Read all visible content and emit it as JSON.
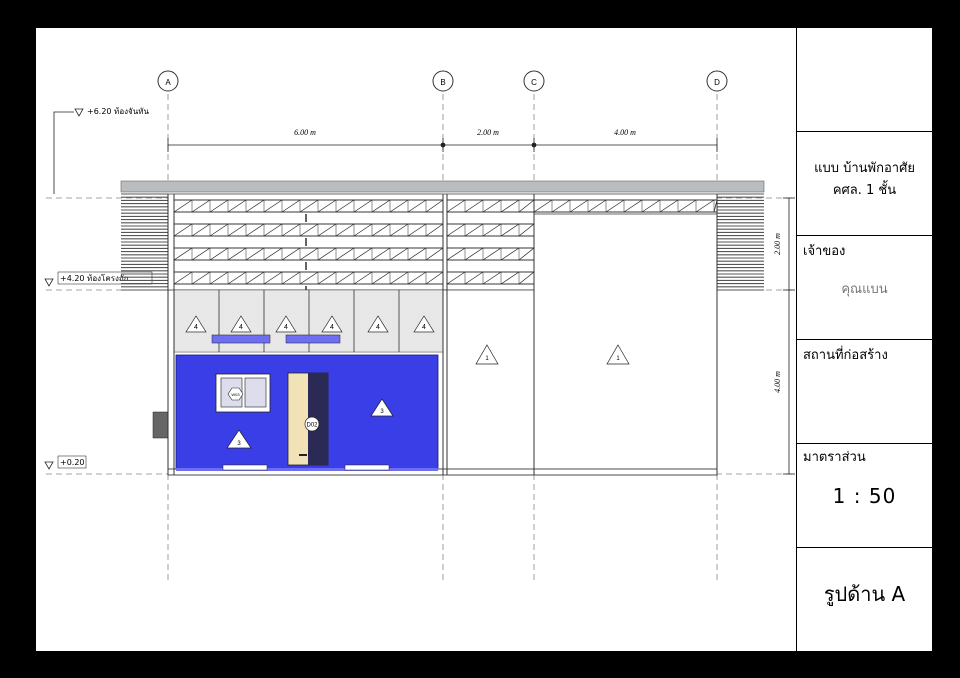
{
  "grid": {
    "A": "A",
    "B": "B",
    "C": "C",
    "D": "D"
  },
  "dimensions": {
    "ab": "6.00 m",
    "bc": "2.00 m",
    "cd": "4.00 m",
    "upper_height": "2.00 m",
    "lower_height": "4.00 m"
  },
  "levels": {
    "roof": "+6.20 ท้องจันทัน",
    "truss": "+4.20 ท้องโครงถัก",
    "floor": "+0.20"
  },
  "tags": {
    "wall_tag": "4",
    "panel_tag_1": "1",
    "panel_tag_3": "3",
    "window_tag": "W03",
    "door_tag": "D02"
  },
  "title_block": {
    "project_line1": "แบบ บ้านพักอาศัย",
    "project_line2": "คศล. 1 ชั้น",
    "owner_label": "เจ้าของ",
    "owner_value": "คุณแบน",
    "site_label": "สถานที่ก่อสร้าง",
    "scale_label": "มาตราส่วน",
    "scale_value": "1 : 50",
    "sheet_title": "รูปด้าน A"
  },
  "colors": {
    "wall_blue": "#3a3ee6",
    "door_fill": "#f2e2b8",
    "roof_grey": "#b9bdbf",
    "sill": "#6e6ef0"
  }
}
